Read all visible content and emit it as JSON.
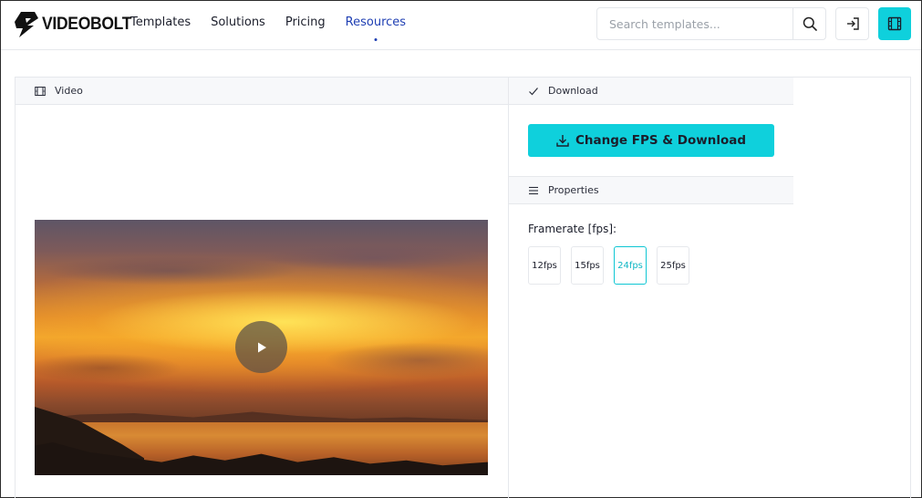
{
  "brand": {
    "name": "VIDEOBOLT"
  },
  "nav": [
    {
      "label": "Templates",
      "active": false
    },
    {
      "label": "Solutions",
      "active": false
    },
    {
      "label": "Pricing",
      "active": false
    },
    {
      "label": "Resources",
      "active": true
    }
  ],
  "search": {
    "placeholder": "Search templates...",
    "value": ""
  },
  "icons": {
    "search": "search-icon",
    "login": "login-icon",
    "film": "film-icon",
    "check": "check-icon",
    "menu": "menu-icon",
    "download": "download-icon",
    "play": "play-icon"
  },
  "video_panel": {
    "title": "Video"
  },
  "download_panel": {
    "title": "Download",
    "button_label": "Change FPS & Download"
  },
  "properties_panel": {
    "title": "Properties",
    "framerate_label": "Framerate [fps]:",
    "fps_options": [
      "12fps",
      "15fps",
      "24fps",
      "25fps"
    ],
    "selected_fps": "24fps"
  },
  "colors": {
    "accent": "#0fd0dc",
    "nav_active": "#1f3fb3",
    "border": "#e6e8ec"
  }
}
